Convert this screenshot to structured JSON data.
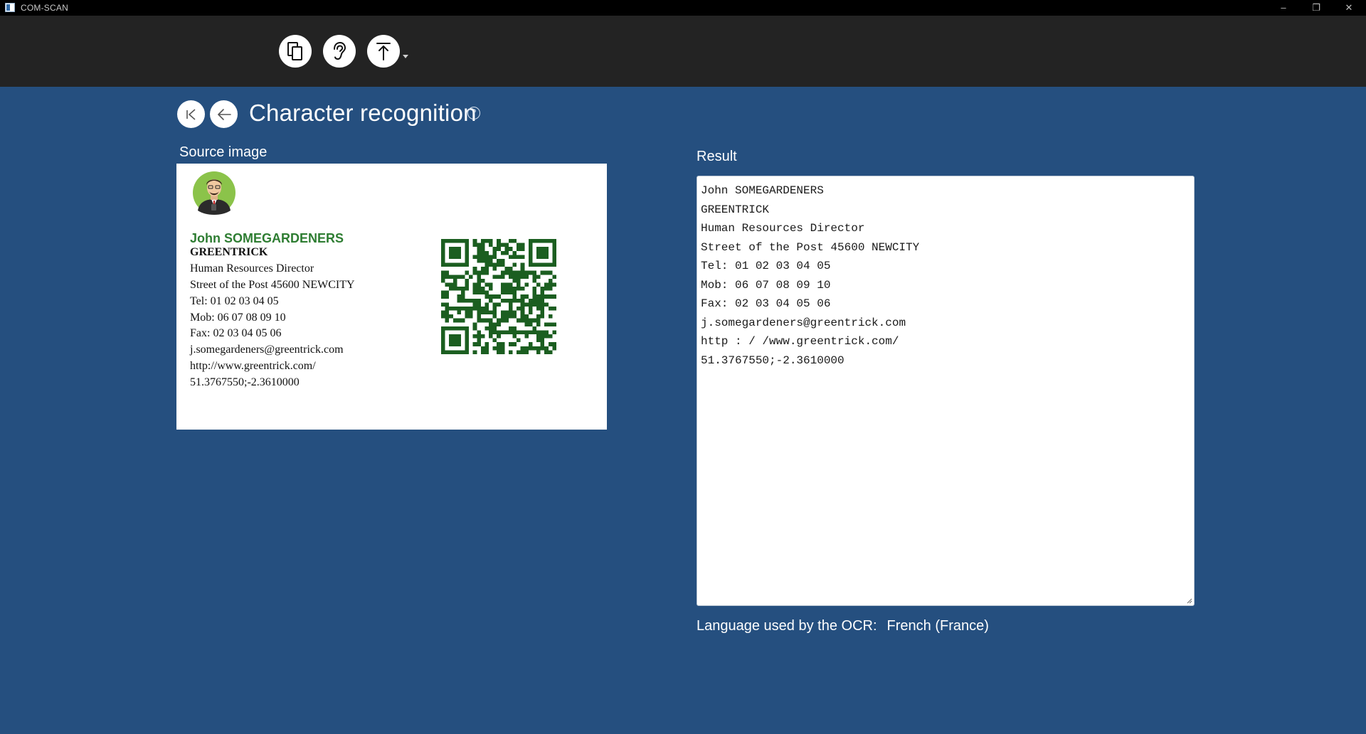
{
  "window": {
    "title": "COM-SCAN",
    "minimize_glyph": "–",
    "restore_glyph": "❐",
    "close_glyph": "✕"
  },
  "toolbar": {
    "buttons": [
      {
        "icon": "copy-icon"
      },
      {
        "icon": "ear-icon"
      },
      {
        "icon": "upload-icon",
        "has_dropdown": true
      }
    ]
  },
  "header": {
    "title": "Character recognition",
    "help_glyph": "?"
  },
  "source": {
    "label": "Source image",
    "card": {
      "name": "John SOMEGARDENERS",
      "company": "GREENTRICK",
      "lines": [
        "Human Resources Director",
        "Street of the Post 45600 NEWCITY",
        "Tel: 01 02 03 04 05",
        "Mob: 06 07 08 09 10",
        "Fax: 02 03 04 05 06",
        "j.somegardeners@greentrick.com",
        "http://www.greentrick.com/",
        "51.3767550;-2.3610000"
      ],
      "name_color": "#2e7d32",
      "qr_color": "#1b5e20"
    }
  },
  "result": {
    "label": "Result",
    "lines": [
      "John SOMEGARDENERS",
      "GREENTRICK",
      "Human Resources Director",
      "Street of the Post 45600 NEWCITY",
      "Tel: 01 02 03 04 05",
      "Mob: 06 07 08 09 10",
      "Fax: 02 03 04 05 06",
      "j.somegardeners@greentrick.com",
      "http : / /www.greentrick.com/",
      "51.3767550;-2.3610000"
    ]
  },
  "ocr": {
    "label": "Language used by the OCR:",
    "language": "French (France)"
  },
  "colors": {
    "background": "#254f7f",
    "toolbar": "#232323",
    "titlebar": "#000000"
  }
}
